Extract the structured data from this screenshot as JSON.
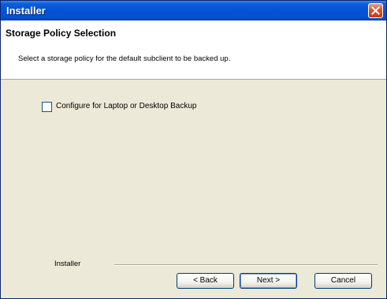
{
  "window": {
    "title": "Installer",
    "close_icon": "close-icon"
  },
  "header": {
    "title": "Storage Policy Selection",
    "description": "Select a storage policy for the default subclient to be backed up."
  },
  "options": {
    "laptop_backup_label": "Configure for Laptop or Desktop Backup",
    "laptop_backup_checked": false
  },
  "footer": {
    "brand_label": "Installer",
    "back_label": "< Back",
    "next_label": "Next >",
    "cancel_label": "Cancel"
  },
  "colors": {
    "titlebar": "#0553d6",
    "close_button": "#d9532f",
    "dialog_bg": "#ece9d8",
    "header_bg": "#ffffff"
  }
}
